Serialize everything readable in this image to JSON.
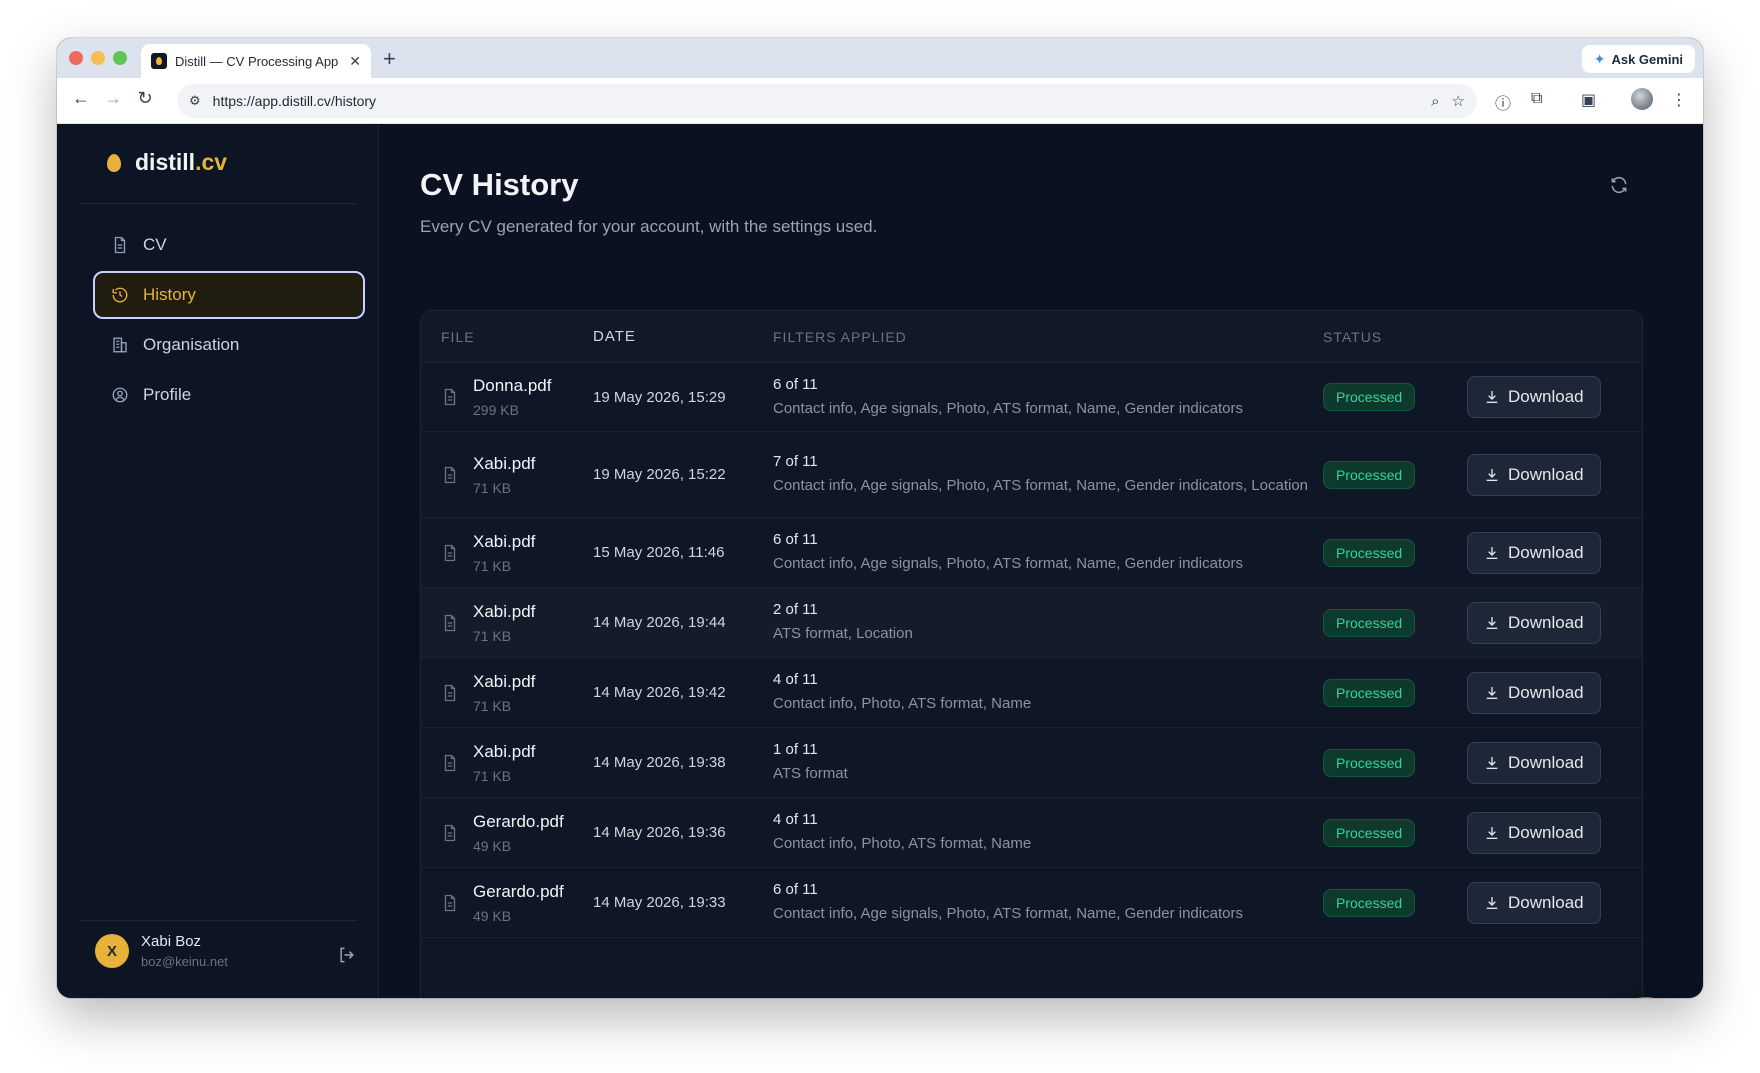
{
  "browser": {
    "tab_title": "Distill — CV Processing App",
    "tab_close": "✕",
    "new_tab": "+",
    "gemini_label": "Ask Gemini",
    "url": "https://app.distill.cv/history"
  },
  "brand": {
    "name_main": "distill",
    "name_accent": ".cv"
  },
  "sidebar": {
    "items": [
      {
        "label": "CV",
        "icon": "document-icon",
        "active": false
      },
      {
        "label": "History",
        "icon": "history-icon",
        "active": true
      },
      {
        "label": "Organisation",
        "icon": "building-icon",
        "active": false
      },
      {
        "label": "Profile",
        "icon": "user-circle-icon",
        "active": false
      }
    ],
    "user": {
      "initial": "X",
      "name": "Xabi Boz",
      "email": "boz@keinu.net"
    }
  },
  "page": {
    "title": "CV History",
    "subtitle": "Every CV generated for your account, with the settings used."
  },
  "table": {
    "headers": {
      "file": "FILE",
      "date": "DATE",
      "filters": "FILTERS APPLIED",
      "status": "STATUS"
    },
    "download_label": "Download",
    "rows": [
      {
        "name": "Donna.pdf",
        "size": "299 KB",
        "date": "19 May 2026, 15:29",
        "count": "6 of 11",
        "filters": "Contact info, Age signals, Photo, ATS format, Name, Gender indicators",
        "status": "Processed"
      },
      {
        "name": "Xabi.pdf",
        "size": "71 KB",
        "date": "19 May 2026, 15:22",
        "count": "7 of 11",
        "filters": "Contact info, Age signals, Photo, ATS format, Name, Gender indicators, Location",
        "status": "Processed"
      },
      {
        "name": "Xabi.pdf",
        "size": "71 KB",
        "date": "15 May 2026, 11:46",
        "count": "6 of 11",
        "filters": "Contact info, Age signals, Photo, ATS format, Name, Gender indicators",
        "status": "Processed"
      },
      {
        "name": "Xabi.pdf",
        "size": "71 KB",
        "date": "14 May 2026, 19:44",
        "count": "2 of 11",
        "filters": "ATS format, Location",
        "status": "Processed"
      },
      {
        "name": "Xabi.pdf",
        "size": "71 KB",
        "date": "14 May 2026, 19:42",
        "count": "4 of 11",
        "filters": "Contact info, Photo, ATS format, Name",
        "status": "Processed"
      },
      {
        "name": "Xabi.pdf",
        "size": "71 KB",
        "date": "14 May 2026, 19:38",
        "count": "1 of 11",
        "filters": "ATS format",
        "status": "Processed"
      },
      {
        "name": "Gerardo.pdf",
        "size": "49 KB",
        "date": "14 May 2026, 19:36",
        "count": "4 of 11",
        "filters": "Contact info, Photo, ATS format, Name",
        "status": "Processed"
      },
      {
        "name": "Gerardo.pdf",
        "size": "49 KB",
        "date": "14 May 2026, 19:33",
        "count": "6 of 11",
        "filters": "Contact info, Age signals, Photo, ATS format, Name, Gender indicators",
        "status": "Processed"
      }
    ]
  },
  "colors": {
    "accent": "#e8b23a",
    "background": "#0b1120",
    "status_success": "#34d399",
    "chat_button": "#1d8fe8"
  }
}
